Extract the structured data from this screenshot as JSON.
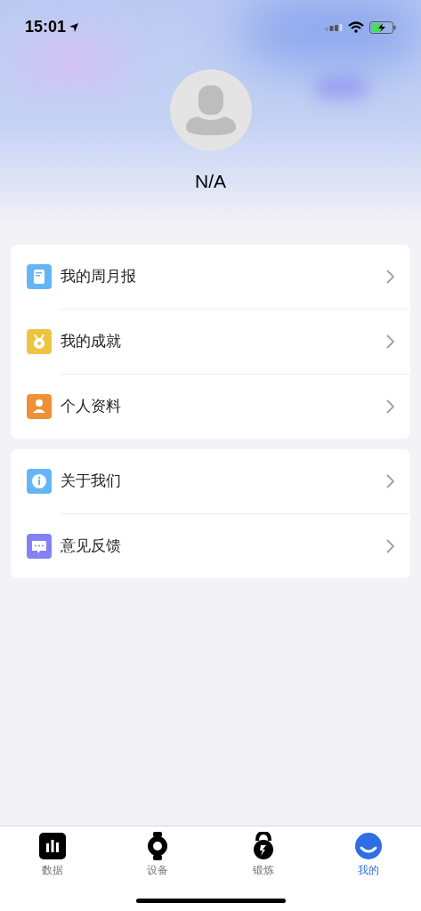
{
  "status_bar": {
    "time": "15:01"
  },
  "profile": {
    "name": "N/A"
  },
  "menu_groups": [
    {
      "items": [
        {
          "label": "我的周月报",
          "kind": "report",
          "color": "#64b5f6"
        },
        {
          "label": "我的成就",
          "kind": "medal",
          "color": "#ecc440"
        },
        {
          "label": "个人资料",
          "kind": "person",
          "color": "#ef9135"
        }
      ]
    },
    {
      "items": [
        {
          "label": "关于我们",
          "kind": "info",
          "color": "#64b5f6"
        },
        {
          "label": "意见反馈",
          "kind": "chat",
          "color": "#8481f4"
        }
      ]
    }
  ],
  "tab_bar": [
    {
      "label": "数据",
      "kind": "data",
      "selected": false
    },
    {
      "label": "设备",
      "kind": "device",
      "selected": false
    },
    {
      "label": "锻炼",
      "kind": "workout",
      "selected": false
    },
    {
      "label": "我的",
      "kind": "me",
      "selected": true
    }
  ]
}
